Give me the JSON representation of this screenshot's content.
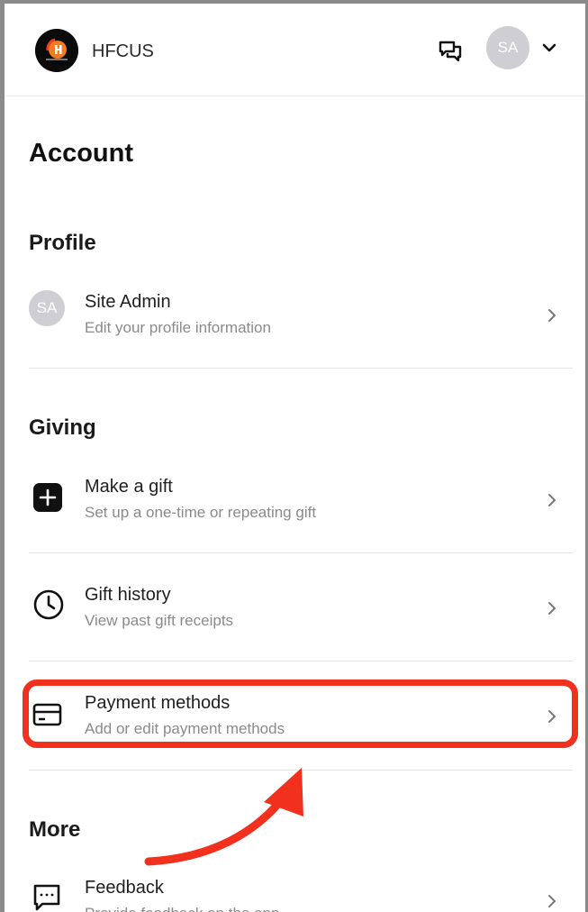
{
  "header": {
    "brand": "HFCUS",
    "avatar_initials": "SA",
    "logo_icon": "church-logo-icon",
    "chat_icon": "chat-bubbles-icon",
    "menu_icon": "chevron-down-icon"
  },
  "page": {
    "title": "Account"
  },
  "profile": {
    "section": "Profile",
    "avatar_initials": "SA",
    "name": "Site Admin",
    "subtitle": "Edit your profile information"
  },
  "giving": {
    "section": "Giving",
    "items": [
      {
        "title": "Make a gift",
        "subtitle": "Set up a one-time or repeating gift",
        "icon": "plus-square-icon"
      },
      {
        "title": "Gift history",
        "subtitle": "View past gift receipts",
        "icon": "clock-icon"
      },
      {
        "title": "Payment methods",
        "subtitle": "Add or edit payment methods",
        "icon": "credit-card-icon"
      }
    ]
  },
  "more": {
    "section": "More",
    "items": [
      {
        "title": "Feedback",
        "subtitle": "Provide feedback on the app",
        "icon": "message-dots-icon"
      }
    ]
  },
  "colors": {
    "highlight": "#f1301d",
    "text": "#1f1f1f",
    "muted": "#8a8a8a",
    "avatar": "#cfcfd3"
  }
}
